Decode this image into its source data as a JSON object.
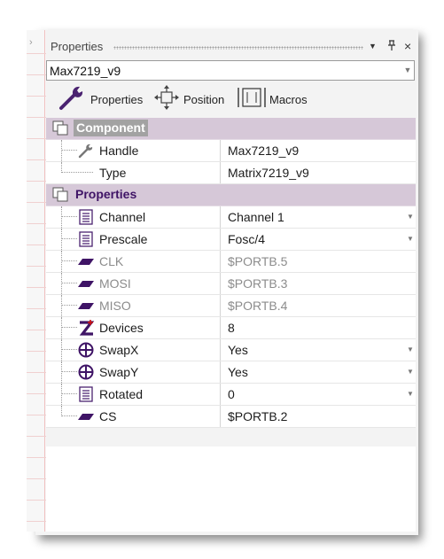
{
  "panel": {
    "title": "Properties",
    "pin_icon": "pin-icon",
    "close_icon": "close-icon",
    "menu_icon": "dropdown-triangle-icon"
  },
  "component_selector": {
    "value": "Max7219_v9"
  },
  "toolbar": {
    "properties_label": "Properties",
    "position_label": "Position",
    "macros_label": "Macros"
  },
  "categories": {
    "component": "Component",
    "properties": "Properties"
  },
  "component_rows": [
    {
      "name": "Handle",
      "value": "Max7219_v9",
      "icon": "wrench-icon"
    },
    {
      "name": "Type",
      "value": "Matrix7219_v9",
      "icon": ""
    }
  ],
  "property_rows": [
    {
      "name": "Channel",
      "value": "Channel 1",
      "icon": "list-icon",
      "dropdown": true,
      "dim": false
    },
    {
      "name": "Prescale",
      "value": "Fosc/4",
      "icon": "list-icon",
      "dropdown": true,
      "dim": false
    },
    {
      "name": "CLK",
      "value": "$PORTB.5",
      "icon": "pin-parallelogram-icon",
      "dropdown": false,
      "dim": true
    },
    {
      "name": "MOSI",
      "value": "$PORTB.3",
      "icon": "pin-parallelogram-icon",
      "dropdown": false,
      "dim": true
    },
    {
      "name": "MISO",
      "value": "$PORTB.4",
      "icon": "pin-parallelogram-icon",
      "dropdown": false,
      "dim": true
    },
    {
      "name": "Devices",
      "value": "8",
      "icon": "z-number-icon",
      "dropdown": false,
      "dim": false
    },
    {
      "name": "SwapX",
      "value": "Yes",
      "icon": "circle-cross-icon",
      "dropdown": true,
      "dim": false
    },
    {
      "name": "SwapY",
      "value": "Yes",
      "icon": "circle-cross-icon",
      "dropdown": true,
      "dim": false
    },
    {
      "name": "Rotated",
      "value": "0",
      "icon": "list-icon",
      "dropdown": true,
      "dim": false
    },
    {
      "name": "CS",
      "value": "$PORTB.2",
      "icon": "pin-parallelogram-icon",
      "dropdown": false,
      "dim": false
    }
  ],
  "colors": {
    "category_bg": "#d6c8d8",
    "accent_purple": "#3f1466",
    "dim_text": "#8c8c8c"
  }
}
